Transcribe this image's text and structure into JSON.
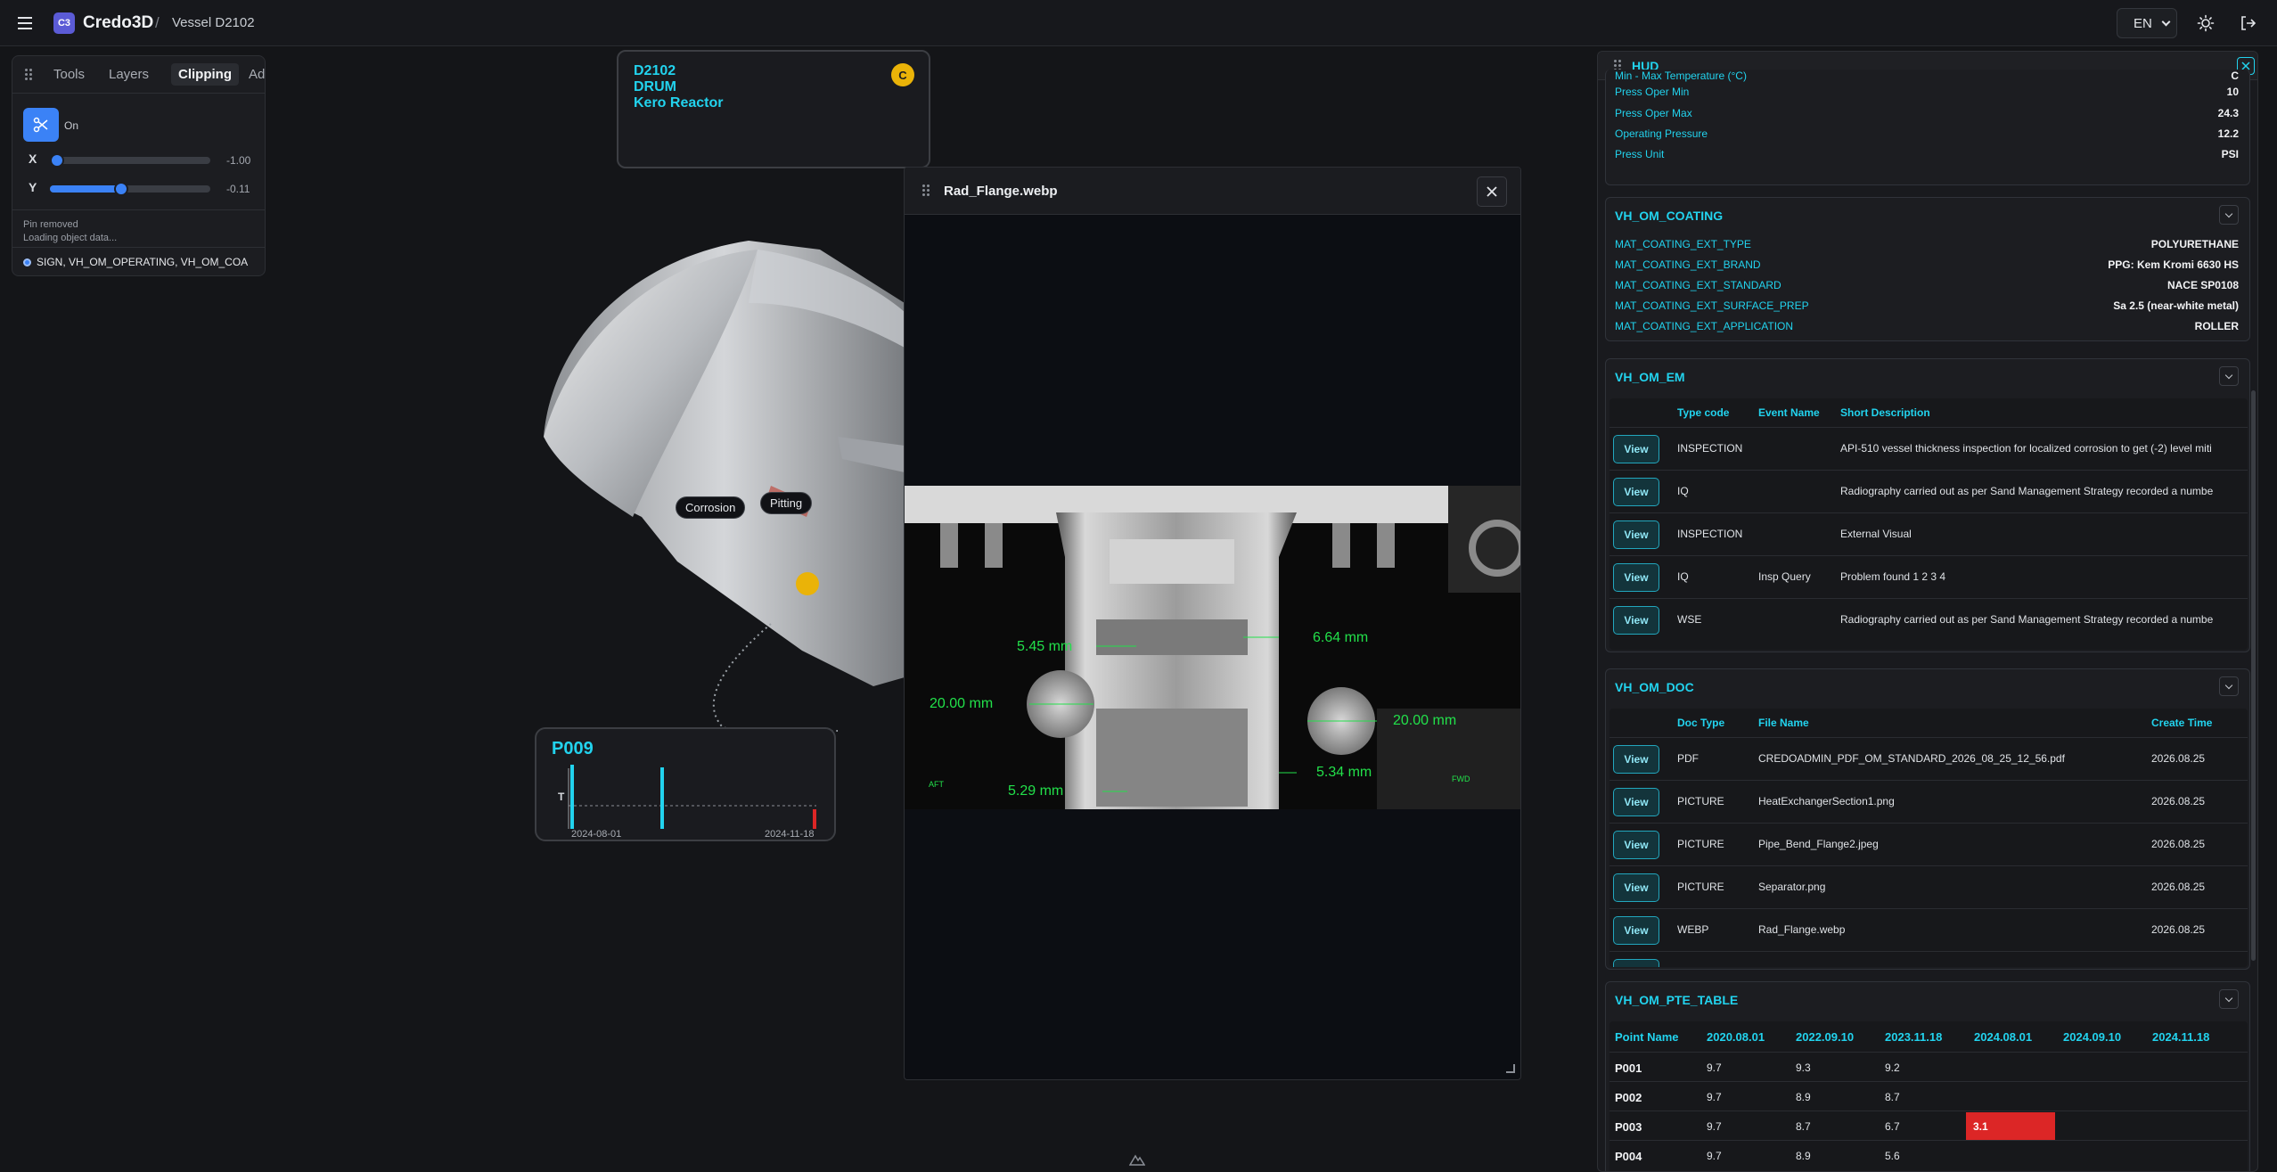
{
  "app": {
    "logo": "C3",
    "title": "Credo3D",
    "separator": "/",
    "breadcrumb": "Vessel D2102"
  },
  "topbar": {
    "language": "EN"
  },
  "left_panel": {
    "tabs": [
      "Tools",
      "Layers",
      "Clipping",
      "Ad"
    ],
    "active_tab": "Clipping",
    "clip_toggle": "On",
    "x_label": "X",
    "x_value": "-1.00",
    "x_level": 0,
    "y_label": "Y",
    "y_value": "-0.11",
    "y_level": 0.445,
    "status_1": "Pin removed",
    "status_2": "Loading object data...",
    "layer": "SIGN, VH_OM_OPERATING, VH_OM_COA"
  },
  "info_card": {
    "line1": "D2102",
    "line2": "DRUM",
    "line3": "Kero Reactor",
    "status": "C"
  },
  "pins": {
    "corrosion": "Corrosion",
    "pitting": "Pitting"
  },
  "p_card": {
    "title": "P009",
    "t_label": "T",
    "date_start": "2024-08-01",
    "date_end": "2024-11-18"
  },
  "viewer": {
    "title": "Rad_Flange.webp",
    "measurements": {
      "top_left": "5.45  mm",
      "top_right": "6.64  mm",
      "mid_left": "20.00  mm",
      "mid_right": "20.00  mm",
      "bot_left": "5.29  mm",
      "bot_right": "5.34  mm",
      "aft": "AFT",
      "fwd": "FWD"
    }
  },
  "hud": {
    "title": "HUD",
    "operating": [
      {
        "k": "Min - Max Temperature (°C)",
        "v": "C"
      },
      {
        "k": "Press Oper Min",
        "v": "10"
      },
      {
        "k": "Press Oper Max",
        "v": "24.3"
      },
      {
        "k": "Operating Pressure",
        "v": "12.2"
      },
      {
        "k": "Press Unit",
        "v": "PSI"
      }
    ],
    "coating": {
      "title": "VH_OM_COATING",
      "items": [
        {
          "k": "MAT_COATING_EXT_TYPE",
          "v": "POLYURETHANE"
        },
        {
          "k": "MAT_COATING_EXT_BRAND",
          "v": "PPG: Kem Kromi 6630 HS"
        },
        {
          "k": "MAT_COATING_EXT_STANDARD",
          "v": "NACE SP0108"
        },
        {
          "k": "MAT_COATING_EXT_SURFACE_PREP",
          "v": "Sa 2.5 (near-white metal)"
        },
        {
          "k": "MAT_COATING_EXT_APPLICATION",
          "v": "ROLLER"
        }
      ]
    },
    "em": {
      "title": "VH_OM_EM",
      "columns": [
        "Type code",
        "Event Name",
        "Short Description"
      ],
      "view_label": "View",
      "rows": [
        [
          "INSPECTION",
          "",
          "API-510 vessel thickness inspection for localized corrosion to get (-2) level miti"
        ],
        [
          "IQ",
          "",
          "Radiography carried out as per Sand Management Strategy recorded a numbe"
        ],
        [
          "INSPECTION",
          "",
          "External Visual"
        ],
        [
          "IQ",
          "Insp Query",
          "Problem found 1 2 3 4"
        ],
        [
          "WSE",
          "",
          "Radiography carried out as per Sand Management Strategy recorded a numbe"
        ]
      ]
    },
    "doc": {
      "title": "VH_OM_DOC",
      "columns": [
        "Doc Type",
        "File Name",
        "Create Time"
      ],
      "view_label": "View",
      "rows": [
        [
          "PDF",
          "CREDOADMIN_PDF_OM_STANDARD_2026_08_25_12_56.pdf",
          "2026.08.25"
        ],
        [
          "PICTURE",
          "HeatExchangerSection1.png",
          "2026.08.25"
        ],
        [
          "PICTURE",
          "Pipe_Bend_Flange2.jpeg",
          "2026.08.25"
        ],
        [
          "PICTURE",
          "Separator.png",
          "2026.08.25"
        ],
        [
          "WEBP",
          "Rad_Flange.webp",
          "2026.08.25"
        ]
      ]
    },
    "pte": {
      "title": "VH_OM_PTE_TABLE",
      "columns": [
        "Point Name",
        "2020.08.01",
        "2022.09.10",
        "2023.11.18",
        "2024.08.01",
        "2024.09.10",
        "2024.11.18"
      ],
      "rows": [
        [
          "P001",
          "9.7",
          "9.3",
          "9.2",
          "",
          "",
          ""
        ],
        [
          "P002",
          "9.7",
          "8.9",
          "8.7",
          "",
          "",
          ""
        ],
        [
          "P003",
          "9.7",
          "8.7",
          "6.7",
          "3.1",
          "",
          ""
        ],
        [
          "P004",
          "9.7",
          "8.9",
          "5.6",
          "",
          "",
          ""
        ]
      ],
      "alert_color": "#dc2626"
    }
  }
}
